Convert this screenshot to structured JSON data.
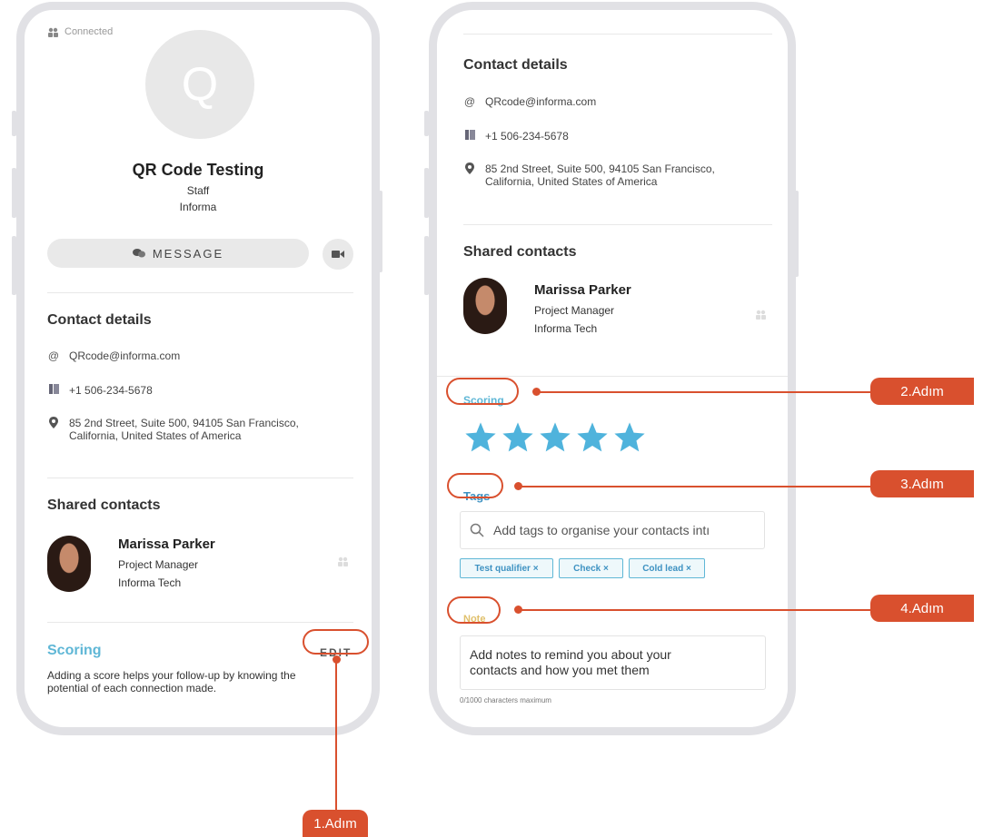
{
  "left_screen": {
    "status": "Connected",
    "avatar_initial": "Q",
    "profile": {
      "name": "QR Code Testing",
      "role": "Staff",
      "company": "Informa"
    },
    "message_label": "MESSAGE",
    "contact_details": {
      "title": "Contact details",
      "email": "QRcode@informa.com",
      "phone": "+1 506-234-5678",
      "address_line1": "85 2nd Street, Suite 500, 94105 San Francisco,",
      "address_line2": "California, United States of America"
    },
    "shared_contacts": {
      "title": "Shared contacts",
      "contact": {
        "name": "Marissa Parker",
        "role": "Project Manager",
        "company": "Informa Tech"
      }
    },
    "scoring": {
      "title": "Scoring",
      "edit_label": "EDIT",
      "description_line1": "Adding a score helps your follow-up by knowing the",
      "description_line2": "potential of each connection made."
    }
  },
  "right_screen": {
    "contact_details": {
      "title": "Contact details",
      "email": "QRcode@informa.com",
      "phone": "+1 506-234-5678",
      "address_line1": "85 2nd Street, Suite 500, 94105 San Francisco,",
      "address_line2": "California, United States of America"
    },
    "shared_contacts": {
      "title": "Shared contacts",
      "contact": {
        "name": "Marissa Parker",
        "role": "Project Manager",
        "company": "Informa Tech"
      }
    },
    "scoring": {
      "title": "Scoring",
      "rating": 5,
      "max_rating": 5
    },
    "tags": {
      "title": "Tags",
      "search_placeholder": "Add tags to organise your contacts intı",
      "chips": [
        {
          "label": "Test qualifier ×"
        },
        {
          "label": "Check ×"
        },
        {
          "label": "Cold lead ×"
        }
      ]
    },
    "note": {
      "title": "Note",
      "placeholder_line1": "Add notes to remind you about your",
      "placeholder_line2": "contacts and how you met them",
      "char_limit": "0/1000 characters maximum"
    }
  },
  "callouts": {
    "step1": "1.Adım",
    "step2": "2.Adım",
    "step3": "3.Adım",
    "step4": "4.Adım"
  },
  "colors": {
    "accent_orange": "#d9502e",
    "scoring_blue": "#5fb7d6",
    "tag_blue": "#3e92c2",
    "note_yellow": "#e0c06b",
    "star_blue": "#4fb3dc",
    "frame_gray": "#e1e1e5"
  },
  "icons": {
    "status": "people-icon",
    "message": "chat-icon",
    "video": "video-camera-icon",
    "email": "at-icon",
    "phone": "phone-icon",
    "address": "location-pin-icon",
    "search": "search-icon",
    "star": "star-icon"
  }
}
